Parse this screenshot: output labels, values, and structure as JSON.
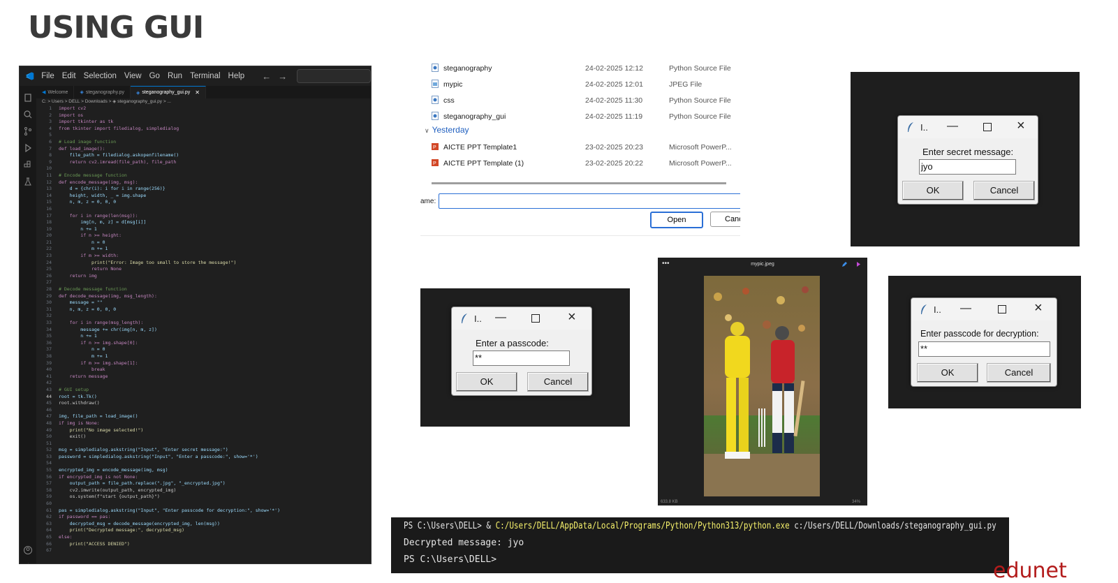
{
  "slide": {
    "title": "USING GUI",
    "brand": "edunet"
  },
  "vscode": {
    "menu": [
      "File",
      "Edit",
      "Selection",
      "View",
      "Go",
      "Run",
      "Terminal",
      "Help"
    ],
    "tabs": [
      "Welcome",
      "steganography.py",
      "steganography_gui.py"
    ],
    "breadcrumb": "C: > Users > DELL > Downloads > ◈ steganography_gui.py > ...",
    "code": [
      "import cv2",
      "import os",
      "import tkinter as tk",
      "from tkinter import filedialog, simpledialog",
      "",
      "# Load image function",
      "def load_image():",
      "    file_path = filedialog.askopenfilename()",
      "    return cv2.imread(file_path), file_path",
      "",
      "# Encode message function",
      "def encode_message(img, msg):",
      "    d = {chr(i): i for i in range(256)}",
      "    height, width, _ = img.shape",
      "    n, m, z = 0, 0, 0",
      "",
      "    for i in range(len(msg)):",
      "        img[n, m, z] = d[msg[i]]",
      "        n += 1",
      "        if n >= height:",
      "            n = 0",
      "            m += 1",
      "        if m >= width:",
      "            print(\"Error: Image too small to store the message!\")",
      "            return None",
      "    return img",
      "",
      "# Decode message function",
      "def decode_message(img, msg_length):",
      "    message = \"\"",
      "    n, m, z = 0, 0, 0",
      "",
      "    for i in range(msg_length):",
      "        message += chr(img[n, m, z])",
      "        n += 1",
      "        if n >= img.shape[0]:",
      "            n = 0",
      "            m += 1",
      "        if m >= img.shape[1]:",
      "            break",
      "    return message",
      "",
      "# GUI setup",
      "root = tk.Tk()",
      "root.withdraw()",
      "",
      "img, file_path = load_image()",
      "if img is None:",
      "    print(\"No image selected!\")",
      "    exit()",
      "",
      "msg = simpledialog.askstring(\"Input\", \"Enter secret message:\")",
      "password = simpledialog.askstring(\"Input\", \"Enter a passcode:\", show='*')",
      "",
      "encrypted_img = encode_message(img, msg)",
      "if encrypted_img is not None:",
      "    output_path = file_path.replace(\".jpg\", \"_encrypted.jpg\")",
      "    cv2.imwrite(output_path, encrypted_img)",
      "    os.system(f\"start {output_path}\")",
      "",
      "pas = simpledialog.askstring(\"Input\", \"Enter passcode for decryption:\", show='*')",
      "if password == pas:",
      "    decrypted_msg = decode_message(encrypted_img, len(msg))",
      "    print(\"Decrypted message:\", decrypted_msg)",
      "else:",
      "    print(\"ACCESS DENIED\")",
      ""
    ]
  },
  "file_dialog": {
    "files": [
      {
        "name": "steganography",
        "date": "24-02-2025 12:12",
        "type": "Python Source File",
        "icon": "python-file-icon"
      },
      {
        "name": "mypic",
        "date": "24-02-2025 12:01",
        "type": "JPEG File",
        "icon": "image-file-icon"
      },
      {
        "name": "css",
        "date": "24-02-2025 11:30",
        "type": "Python Source File",
        "icon": "python-file-icon"
      },
      {
        "name": "steganography_gui",
        "date": "24-02-2025 11:19",
        "type": "Python Source File",
        "icon": "python-file-icon"
      }
    ],
    "group_yesterday": "Yesterday",
    "files_yesterday": [
      {
        "name": "AICTE PPT Template1",
        "date": "23-02-2025 20:23",
        "type": "Microsoft PowerP...",
        "icon": "ppt-file-icon"
      },
      {
        "name": "AICTE PPT Template (1)",
        "date": "23-02-2025 20:22",
        "type": "Microsoft PowerP...",
        "icon": "ppt-file-icon"
      }
    ],
    "filename_label": "ame:",
    "filename_value": "",
    "open_label": "Open",
    "cancel_label": "Canc"
  },
  "dialog_secret": {
    "title": "I..",
    "prompt": "Enter secret message:",
    "value": "jyo",
    "ok": "OK",
    "cancel": "Cancel"
  },
  "dialog_passcode": {
    "title": "I..",
    "prompt": "Enter a passcode:",
    "value": "**",
    "ok": "OK",
    "cancel": "Cancel"
  },
  "dialog_decrypt": {
    "title": "I..",
    "prompt": "Enter passcode for decryption:",
    "value": "**",
    "ok": "OK",
    "cancel": "Cancel"
  },
  "viewer": {
    "title": "mypic.jpeg",
    "dots": "•••",
    "status": "633.8 KB",
    "zoom": "34%"
  },
  "terminal": {
    "line1_prompt": "PS C:\\Users\\DELL> & ",
    "line1_exe": "C:/Users/DELL/AppData/Local/Programs/Python/Python313/python.exe",
    "line1_script": " c:/Users/DELL/Downloads/steganography_gui.py",
    "line2": "Decrypted message: jyo",
    "line3": "PS C:\\Users\\DELL>"
  },
  "colors": {
    "accent": "#0078d4",
    "brand": "#b31c1c",
    "terminal_path": "#f5f06b"
  }
}
